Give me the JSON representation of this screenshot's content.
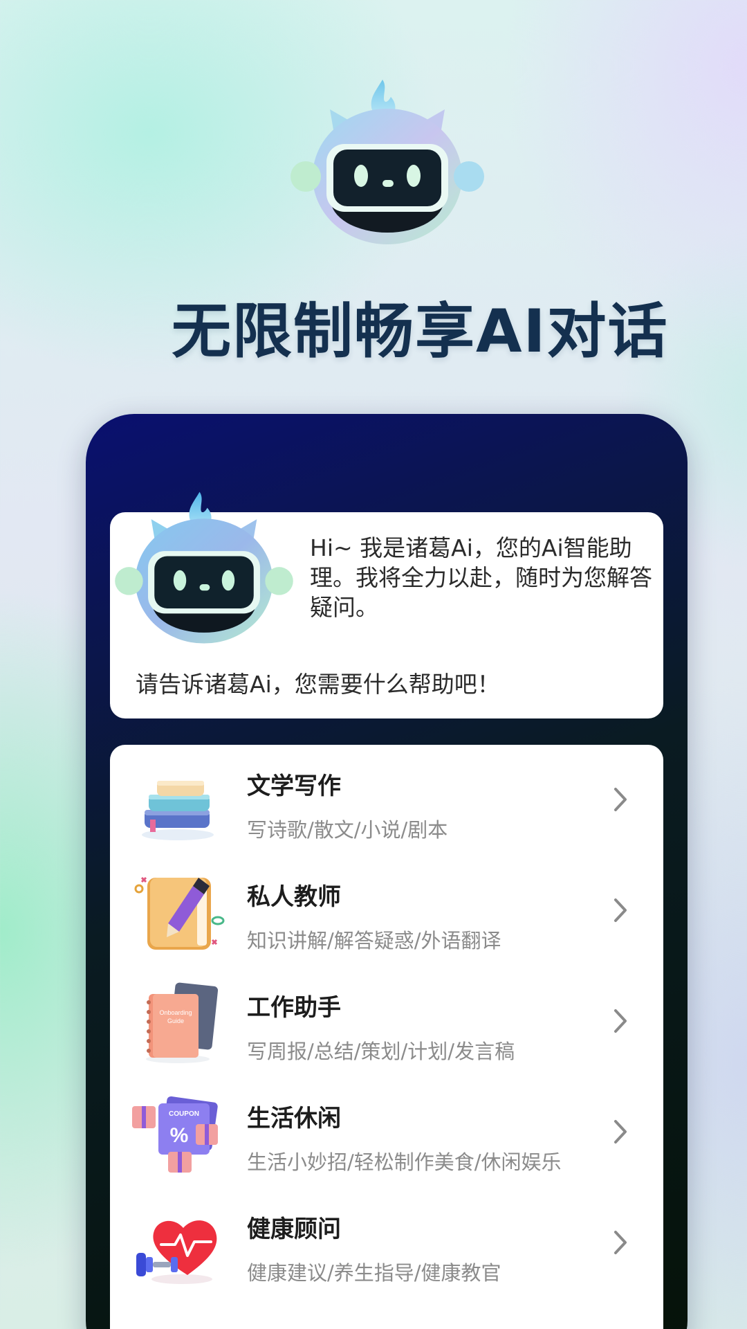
{
  "headline": "无限制畅享AI对话",
  "intro": {
    "greeting": "Hi~ 我是诸葛Ai，您的Ai智能助理。我将全力以赴，随时为您解答疑问。",
    "question": "请告诉诸葛Ai，您需要什么帮助吧！"
  },
  "menu": {
    "items": [
      {
        "title": "文学写作",
        "subtitle": "写诗歌/散文/小说/剧本",
        "icon": "books-icon"
      },
      {
        "title": "私人教师",
        "subtitle": "知识讲解/解答疑惑/外语翻译",
        "icon": "notebook-pencil-icon"
      },
      {
        "title": "工作助手",
        "subtitle": "写周报/总结/策划/计划/发言稿",
        "icon": "onboarding-guide-icon"
      },
      {
        "title": "生活休闲",
        "subtitle": "生活小妙招/轻松制作美食/休闲娱乐",
        "icon": "coupon-gift-icon"
      },
      {
        "title": "健康顾问",
        "subtitle": "健康建议/养生指导/健康教官",
        "icon": "heart-dumbbell-icon"
      }
    ]
  },
  "colors": {
    "headline": "#14304f",
    "phone_top": "#0a1070",
    "phone_bottom": "#051208",
    "card": "#ffffff",
    "subtitle": "#8b8b8b"
  },
  "icon_text": {
    "guide_line1": "Onboarding",
    "guide_line2": "Guide",
    "coupon": "COUPON",
    "percent": "%"
  }
}
